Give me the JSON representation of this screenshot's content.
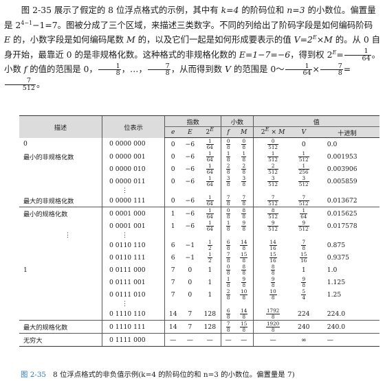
{
  "paragraph": {
    "p1_a": "图 2-35 展示了假定的 8 位浮点格式的示例，其中有 ",
    "k_expr": "k=4",
    "p1_b": " 的阶码位和 ",
    "n_expr": "n=3",
    "p1_c": " 的小数位。偏置量是 ",
    "bias_base": "2",
    "bias_exp": "4−1",
    "bias_rest": "−1=7。图被分成了三个区域，来描述三类数字。不同的列给出了阶码字段是如何编码阶码 ",
    "E_var": "E",
    "p1_d": " 的，小数字段是如何编码尾数 ",
    "M_var": "M",
    "p1_e": " 的，以及它们一起是如何形成要表示的值 ",
    "V_expr": "V=2",
    "V_exp": "E",
    "V_rest": "×M",
    "p1_f": " 的。从 0 自身开始，最靠近 0 的是非规格化数。这种格式的非规格化数的 ",
    "E_calc": "E=1−7=−6",
    "p1_g": "，得到权 ",
    "weight_base": "2",
    "weight_exp": "E",
    "weight_eq": "=",
    "weight_frac": {
      "num": "1",
      "den": "64"
    },
    "p1_h": "。小数 ",
    "f_var": "f",
    "p1_i": " 的值的范围是 0，",
    "f_min": {
      "num": "1",
      "den": "8"
    },
    "p1_j": "，…，",
    "f_max": {
      "num": "7",
      "den": "8"
    },
    "p1_k": "，从而得到数 ",
    "V_var": "V",
    "p1_l": " 的范围是 0～",
    "range_a": {
      "num": "1",
      "den": "64"
    },
    "times": "×",
    "range_b": {
      "num": "7",
      "den": "8"
    },
    "eq": "=",
    "range_c": {
      "num": "7",
      "den": "512"
    },
    "p1_end": "。"
  },
  "table": {
    "headers": {
      "desc": "描述",
      "bits": "位表示",
      "exponent_group": "指数",
      "fraction_group": "小数",
      "value_group": "值",
      "e": "e",
      "E": "E",
      "twoE_base": "2",
      "twoE_exp": "E",
      "f": "f",
      "M": "M",
      "twoEM_base": "2",
      "twoEM_exp": "E",
      "twoEM_rest": " × M",
      "V": "V",
      "decimal": "十进制"
    },
    "rows": [
      {
        "desc": "0",
        "bits": "0 0000 000",
        "e": "0",
        "E": "−6",
        "w": [
          "1",
          "64"
        ],
        "f": [
          "0",
          "8"
        ],
        "M": [
          "0",
          "8"
        ],
        "p": [
          "0",
          "512"
        ],
        "V": "0",
        "dec": "0.0"
      },
      {
        "desc": "最小的非规格化数",
        "bits": "0 0000 001",
        "e": "0",
        "E": "−6",
        "w": [
          "1",
          "64"
        ],
        "f": [
          "1",
          "8"
        ],
        "M": [
          "1",
          "8"
        ],
        "p": [
          "1",
          "512"
        ],
        "V": [
          "1",
          "512"
        ],
        "dec": "0.001953"
      },
      {
        "desc": "",
        "bits": "0 0000 010",
        "e": "0",
        "E": "−6",
        "w": [
          "1",
          "64"
        ],
        "f": [
          "2",
          "8"
        ],
        "M": [
          "2",
          "8"
        ],
        "p": [
          "2",
          "512"
        ],
        "V": [
          "1",
          "256"
        ],
        "dec": "0.003906"
      },
      {
        "desc": "",
        "bits": "0 0000 011",
        "e": "0",
        "E": "−6",
        "w": [
          "1",
          "64"
        ],
        "f": [
          "3",
          "8"
        ],
        "M": [
          "3",
          "8"
        ],
        "p": [
          "3",
          "512"
        ],
        "V": [
          "3",
          "512"
        ],
        "dec": "0.005859"
      },
      {
        "desc": "最大的非规格化数",
        "bits": "0 0000 111",
        "e": "0",
        "E": "−6",
        "w": [
          "1",
          "64"
        ],
        "f": [
          "7",
          "8"
        ],
        "M": [
          "7",
          "8"
        ],
        "p": [
          "7",
          "512"
        ],
        "V": [
          "7",
          "512"
        ],
        "dec": "0.013672"
      },
      {
        "desc": "最小的规格化数",
        "bits": "0 0001 000",
        "e": "1",
        "E": "−6",
        "w": [
          "1",
          "64"
        ],
        "f": [
          "0",
          "8"
        ],
        "M": [
          "8",
          "8"
        ],
        "p": [
          "8",
          "512"
        ],
        "V": [
          "1",
          "64"
        ],
        "dec": "0.015625"
      },
      {
        "desc": "",
        "bits": "0 0001 001",
        "e": "1",
        "E": "−6",
        "w": [
          "1",
          "64"
        ],
        "f": [
          "1",
          "8"
        ],
        "M": [
          "9",
          "8"
        ],
        "p": [
          "9",
          "512"
        ],
        "V": [
          "9",
          "512"
        ],
        "dec": "0.017578"
      },
      {
        "desc": "",
        "bits": "0 0110 110",
        "e": "6",
        "E": "−1",
        "w": [
          "1",
          "2"
        ],
        "f": [
          "6",
          "8"
        ],
        "M": [
          "14",
          "8"
        ],
        "p": [
          "14",
          "16"
        ],
        "V": [
          "7",
          "8"
        ],
        "dec": "0.875"
      },
      {
        "desc": "",
        "bits": "0 0110 111",
        "e": "6",
        "E": "−1",
        "w": [
          "1",
          "2"
        ],
        "f": [
          "7",
          "8"
        ],
        "M": [
          "15",
          "8"
        ],
        "p": [
          "15",
          "16"
        ],
        "V": [
          "15",
          "16"
        ],
        "dec": "0.9375"
      },
      {
        "desc": "1",
        "bits": "0 0111 000",
        "e": "7",
        "E": "0",
        "w": "1",
        "f": [
          "0",
          "8"
        ],
        "M": [
          "8",
          "8"
        ],
        "p": [
          "8",
          "8"
        ],
        "V": "1",
        "dec": "1.0"
      },
      {
        "desc": "",
        "bits": "0 0111 001",
        "e": "7",
        "E": "0",
        "w": "1",
        "f": [
          "1",
          "8"
        ],
        "M": [
          "9",
          "8"
        ],
        "p": [
          "9",
          "8"
        ],
        "V": [
          "9",
          "8"
        ],
        "dec": "1.125"
      },
      {
        "desc": "",
        "bits": "0 0111 010",
        "e": "7",
        "E": "0",
        "w": "1",
        "f": [
          "2",
          "8"
        ],
        "M": [
          "10",
          "8"
        ],
        "p": [
          "10",
          "8"
        ],
        "V": [
          "5",
          "4"
        ],
        "dec": "1.25"
      },
      {
        "desc": "",
        "bits": "0 1110 110",
        "e": "14",
        "E": "7",
        "w": "128",
        "f": [
          "6",
          "8"
        ],
        "M": [
          "14",
          "8"
        ],
        "p": [
          "1792",
          "8"
        ],
        "V": "224",
        "dec": "224.0"
      },
      {
        "desc": "最大的规格化数",
        "bits": "0 1110 111",
        "e": "14",
        "E": "7",
        "w": "128",
        "f": [
          "7",
          "8"
        ],
        "M": [
          "15",
          "8"
        ],
        "p": [
          "1920",
          "8"
        ],
        "V": "240",
        "dec": "240.0"
      },
      {
        "desc": "无穷大",
        "bits": "0 1111 000",
        "e": "—",
        "E": "—",
        "w": "—",
        "f": "—",
        "M": "—",
        "p": "—",
        "V": "∞",
        "dec": "—"
      }
    ],
    "ellipsis": "⋮"
  },
  "caption": {
    "number": "图 2-35",
    "text": "8 位浮点格式的非负值示例(k=4 的阶码位的和 n=3 的小数位。偏置量是 7)"
  }
}
